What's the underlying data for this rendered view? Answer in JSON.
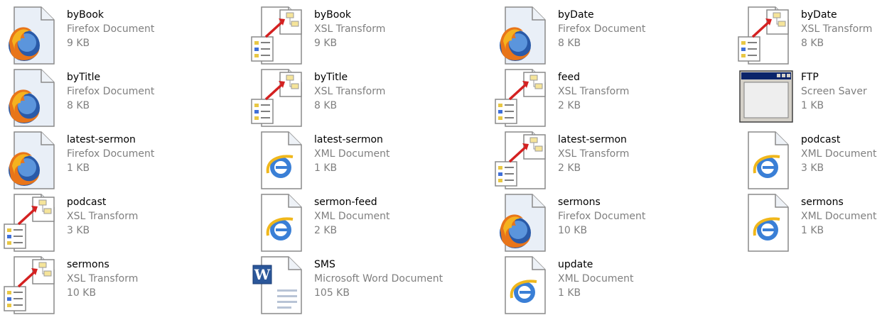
{
  "files": [
    {
      "name": "byBook",
      "type": "Firefox Document",
      "size": "9 KB",
      "icon": "firefox-document-icon"
    },
    {
      "name": "byBook",
      "type": "XSL Transform",
      "size": "9 KB",
      "icon": "xsl-transform-icon"
    },
    {
      "name": "byDate",
      "type": "Firefox Document",
      "size": "8 KB",
      "icon": "firefox-document-icon"
    },
    {
      "name": "byDate",
      "type": "XSL Transform",
      "size": "8 KB",
      "icon": "xsl-transform-icon"
    },
    {
      "name": "byTitle",
      "type": "Firefox Document",
      "size": "8 KB",
      "icon": "firefox-document-icon"
    },
    {
      "name": "byTitle",
      "type": "XSL Transform",
      "size": "8 KB",
      "icon": "xsl-transform-icon"
    },
    {
      "name": "feed",
      "type": "XSL Transform",
      "size": "2 KB",
      "icon": "xsl-transform-icon"
    },
    {
      "name": "FTP",
      "type": "Screen Saver",
      "size": "1 KB",
      "icon": "screen-saver-icon"
    },
    {
      "name": "latest-sermon",
      "type": "Firefox Document",
      "size": "1 KB",
      "icon": "firefox-document-icon"
    },
    {
      "name": "latest-sermon",
      "type": "XML Document",
      "size": "1 KB",
      "icon": "xml-document-icon"
    },
    {
      "name": "latest-sermon",
      "type": "XSL Transform",
      "size": "2 KB",
      "icon": "xsl-transform-icon"
    },
    {
      "name": "podcast",
      "type": "XML Document",
      "size": "3 KB",
      "icon": "xml-document-icon"
    },
    {
      "name": "podcast",
      "type": "XSL Transform",
      "size": "3 KB",
      "icon": "xsl-transform-icon"
    },
    {
      "name": "sermon-feed",
      "type": "XML Document",
      "size": "2 KB",
      "icon": "xml-document-icon"
    },
    {
      "name": "sermons",
      "type": "Firefox Document",
      "size": "10 KB",
      "icon": "firefox-document-icon"
    },
    {
      "name": "sermons",
      "type": "XML Document",
      "size": "1 KB",
      "icon": "xml-document-icon"
    },
    {
      "name": "sermons",
      "type": "XSL Transform",
      "size": "10 KB",
      "icon": "xsl-transform-icon"
    },
    {
      "name": "SMS",
      "type": "Microsoft Word Document",
      "size": "105 KB",
      "icon": "word-document-icon"
    },
    {
      "name": "update",
      "type": "XML Document",
      "size": "1 KB",
      "icon": "xml-document-icon"
    }
  ]
}
